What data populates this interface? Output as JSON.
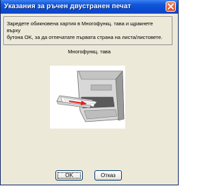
{
  "dialog": {
    "title": "Указания за ръчен двустранен печат"
  },
  "instruction": {
    "line1": "Заредете обикновена хартия в Многофункц. тава и щракнете върху",
    "line2": "бутона OK, за да отпечатате първата страна на листа/листовете."
  },
  "figure": {
    "caption": "Многофункц. тава",
    "icon": "printer-multipurpose-tray-illustration"
  },
  "buttons": {
    "ok_label": "OK",
    "cancel_label": "Отказ"
  },
  "colors": {
    "titlebar": "#0a4ad0",
    "close_button": "#d24a25",
    "dialog_background": "#ece9d8",
    "arrow": "#e0201a"
  }
}
